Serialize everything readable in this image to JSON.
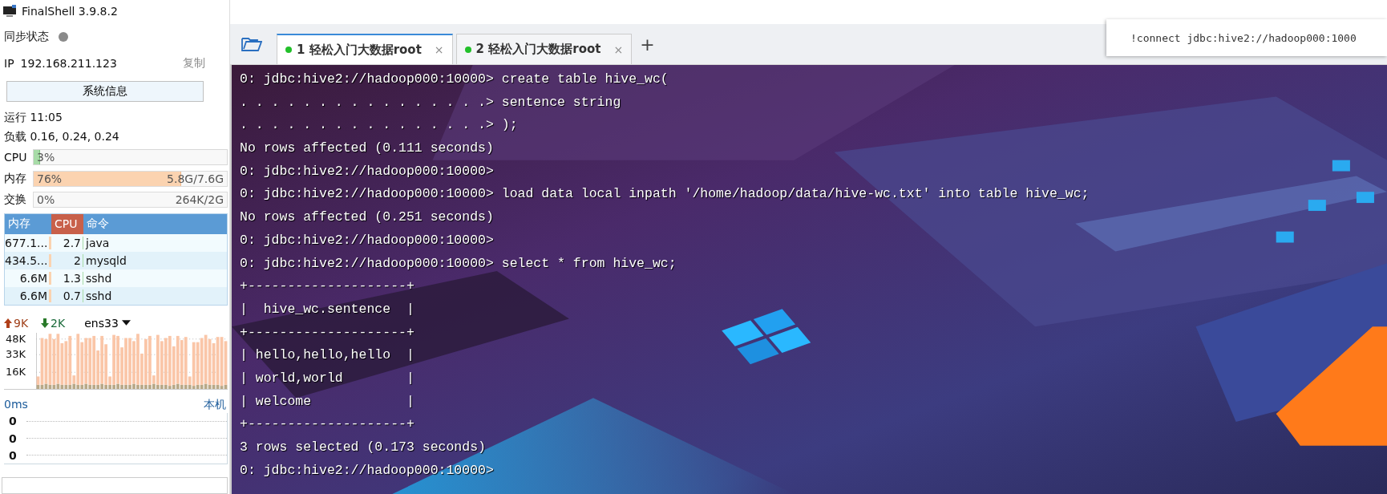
{
  "window": {
    "title": "FinalShell 3.9.8.2"
  },
  "sidebar": {
    "sync_label": "同步状态",
    "ip_label": "IP",
    "ip": "192.168.211.123",
    "copy": "复制",
    "sysinfo_button": "系统信息",
    "uptime": "运行 11:05",
    "load": "负载 0.16, 0.24, 0.24",
    "meters": [
      {
        "label": "CPU",
        "percent": "3%",
        "level": 0.03,
        "kind": "cpu"
      },
      {
        "label": "内存",
        "percent": "76%",
        "detail": "5.8G/7.6G",
        "level": 0.76,
        "kind": "memory"
      },
      {
        "label": "交换",
        "percent": "0%",
        "detail": "264K/2G",
        "kind": "memory"
      }
    ],
    "process_table": {
      "columns": [
        "内存",
        "CPU",
        "命令"
      ],
      "rows": [
        {
          "memory": "677.1...",
          "cpu": "2.7",
          "command": "java"
        },
        {
          "memory": "434.5...",
          "cpu": "2",
          "command": "mysqld"
        },
        {
          "memory": "6.6M",
          "cpu": "1.3",
          "command": "sshd"
        },
        {
          "memory": "6.6M",
          "cpu": "0.7",
          "command": "sshd"
        }
      ]
    },
    "network": {
      "upload": "9K",
      "download": "2K",
      "interface": "ens33",
      "chart_data": {
        "type": "bar",
        "stacked": true,
        "grid": true,
        "ylim": [
          0,
          54
        ],
        "yticks": [
          {
            "value": 16,
            "label": "16K"
          },
          {
            "value": 33,
            "label": "33K"
          },
          {
            "value": 48,
            "label": "48K"
          }
        ],
        "series": [
          {
            "color": "#b8a888",
            "values": [
              4,
              4,
              5,
              4,
              4,
              5,
              4,
              4,
              4,
              5,
              4,
              4,
              5,
              4,
              4,
              4,
              5,
              4,
              4,
              4,
              5,
              4,
              4,
              4,
              5,
              4,
              4,
              4,
              4,
              5,
              4,
              4,
              4,
              3,
              4,
              5,
              4,
              4,
              4,
              3,
              4,
              4,
              5,
              4,
              4,
              4,
              3,
              4
            ]
          },
          {
            "color": "#fac6a8",
            "values": [
              8,
              45,
              43,
              49,
              44,
              48,
              40,
              42,
              47,
              8,
              49,
              41,
              44,
              45,
              47,
              33,
              46,
              39,
              8,
              48,
              46,
              36,
              45,
              45,
              41,
              49,
              30,
              44,
              47,
              8,
              48,
              42,
              45,
              48,
              37,
              46,
              43,
              46,
              8,
              42,
              41,
              45,
              47,
              44,
              40,
              46,
              47,
              42
            ]
          }
        ]
      }
    },
    "latency": {
      "reading": "0ms",
      "host": "本机",
      "labels": [
        "0",
        "0",
        "0"
      ]
    }
  },
  "tabs": [
    {
      "label": "1 轻松入门大数据root",
      "close": "×",
      "selected": true
    },
    {
      "label": "2 轻松入门大数据root",
      "close": "×",
      "selected": false
    }
  ],
  "add_tab": "+",
  "command_hint": "!connect jdbc:hive2://hadoop000:1000",
  "terminal": {
    "lines": [
      "0: jdbc:hive2://hadoop000:10000> create table hive_wc(",
      ". . . . . . . . . . . . . . . .> sentence string",
      ". . . . . . . . . . . . . . . .> );",
      "No rows affected (0.111 seconds)",
      "0: jdbc:hive2://hadoop000:10000>",
      "0: jdbc:hive2://hadoop000:10000> load data local inpath '/home/hadoop/data/hive-wc.txt' into table hive_wc;",
      "No rows affected (0.251 seconds)",
      "0: jdbc:hive2://hadoop000:10000>",
      "0: jdbc:hive2://hadoop000:10000> select * from hive_wc;",
      "+--------------------+",
      "|  hive_wc.sentence  |",
      "+--------------------+",
      "| hello,hello,hello  |",
      "| world,world        |",
      "| welcome            |",
      "+--------------------+",
      "3 rows selected (0.173 seconds)",
      "0: jdbc:hive2://hadoop000:10000>"
    ]
  }
}
